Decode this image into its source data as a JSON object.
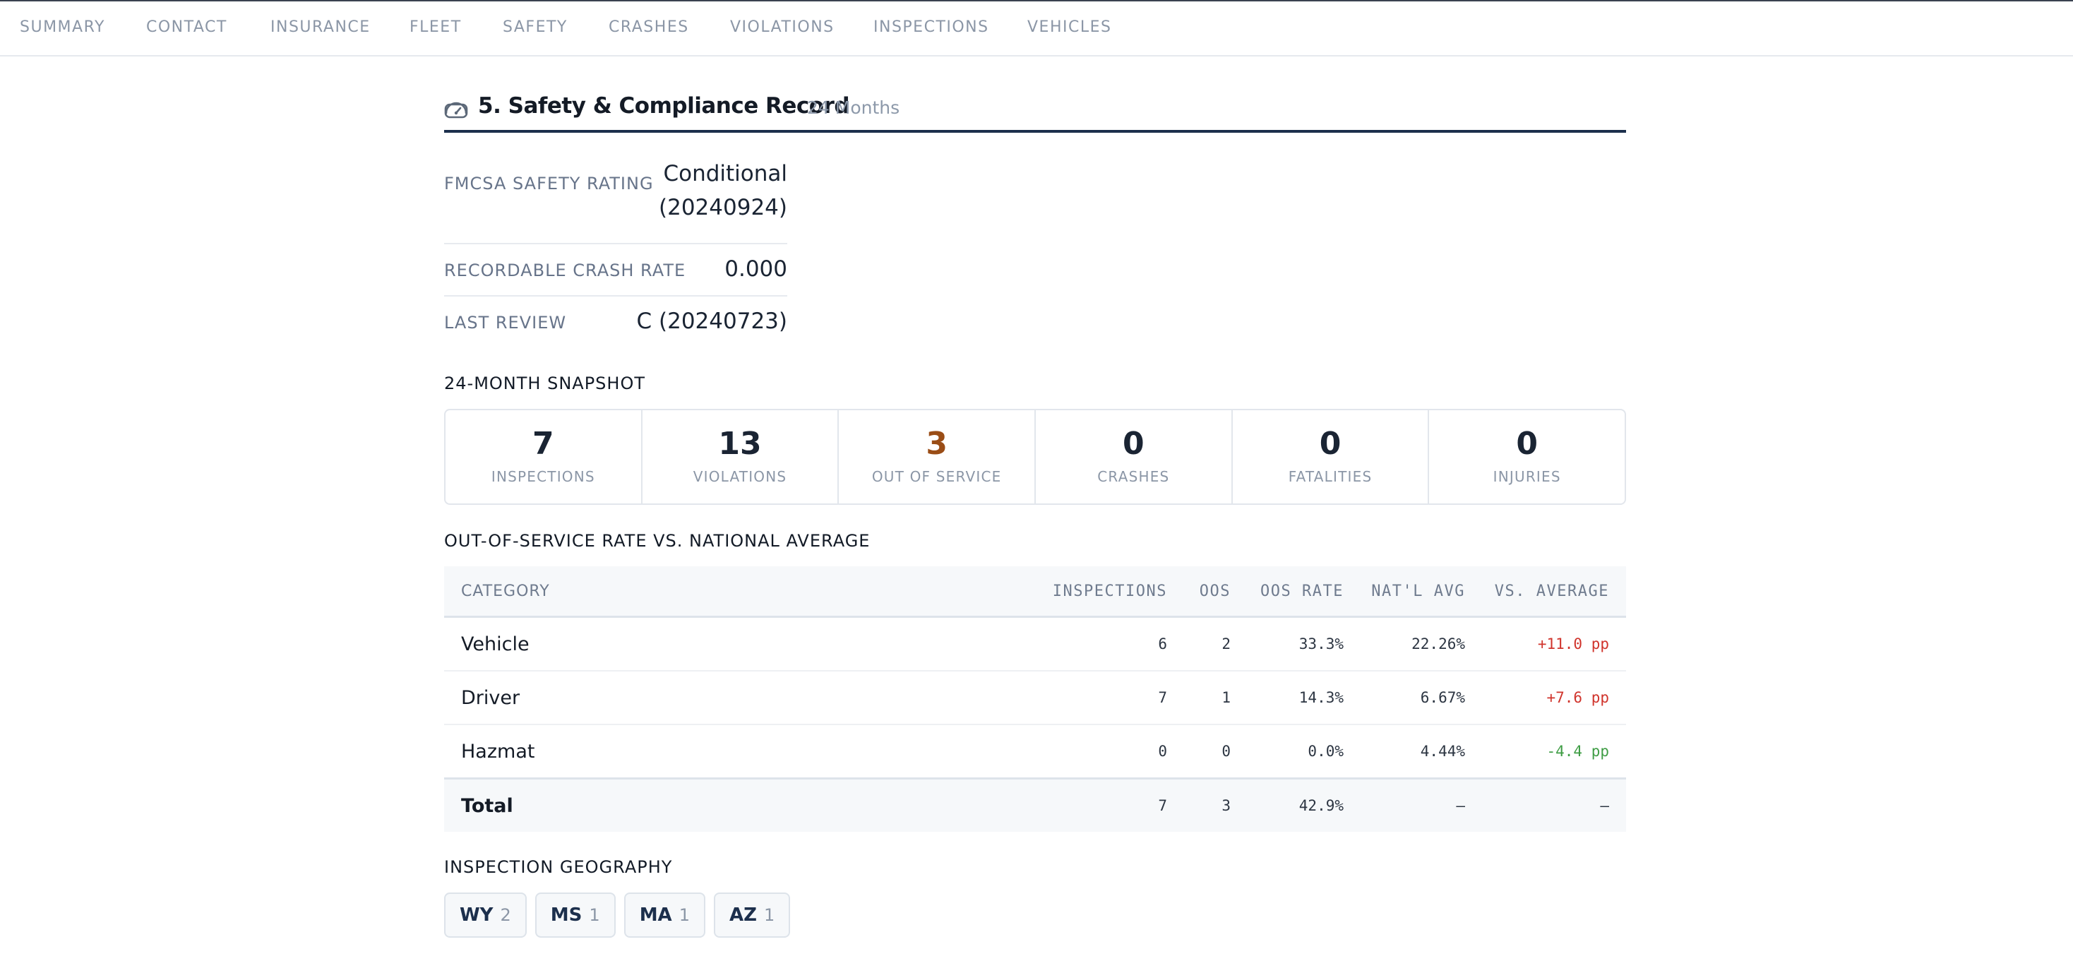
{
  "nav": {
    "tabs": [
      {
        "label": "SUMMARY"
      },
      {
        "label": "CONTACT"
      },
      {
        "label": "INSURANCE"
      },
      {
        "label": "FLEET"
      },
      {
        "label": "SAFETY"
      },
      {
        "label": "CRASHES"
      },
      {
        "label": "VIOLATIONS"
      },
      {
        "label": "INSPECTIONS"
      },
      {
        "label": "VEHICLES"
      }
    ]
  },
  "section": {
    "icon": "gauge-icon",
    "title": "5. Safety & Compliance Record",
    "subtitle": "24 Months"
  },
  "ratings": [
    {
      "label": "FMCSA SAFETY RATING",
      "value": "Conditional (20240924)"
    },
    {
      "label": "RECORDABLE CRASH RATE",
      "value": "0.000"
    },
    {
      "label": "LAST REVIEW",
      "value": "C (20240723)"
    }
  ],
  "snapshot": {
    "heading": "24-MONTH SNAPSHOT",
    "stats": [
      {
        "value": "7",
        "label": "INSPECTIONS"
      },
      {
        "value": "13",
        "label": "VIOLATIONS"
      },
      {
        "value": "3",
        "label": "OUT OF SERVICE"
      },
      {
        "value": "0",
        "label": "CRASHES"
      },
      {
        "value": "0",
        "label": "FATALITIES"
      },
      {
        "value": "0",
        "label": "INJURIES"
      }
    ],
    "accent_color": "#9a4d16"
  },
  "oos": {
    "heading": "OUT-OF-SERVICE RATE VS. NATIONAL AVERAGE",
    "columns": [
      "CATEGORY",
      "INSPECTIONS",
      "OOS",
      "OOS RATE",
      "NAT'L AVG",
      "VS. AVERAGE"
    ],
    "rows": [
      {
        "category": "Vehicle",
        "inspections": "6",
        "oos": "2",
        "rate": "33.3%",
        "avg": "22.26%",
        "vs": "+11.0 pp"
      },
      {
        "category": "Driver",
        "inspections": "7",
        "oos": "1",
        "rate": "14.3%",
        "avg": "6.67%",
        "vs": "+7.6 pp"
      },
      {
        "category": "Hazmat",
        "inspections": "0",
        "oos": "0",
        "rate": "0.0%",
        "avg": "4.44%",
        "vs": "-4.4 pp"
      }
    ],
    "total": {
      "category": "Total",
      "inspections": "7",
      "oos": "3",
      "rate": "42.9%",
      "avg": "—",
      "vs": "—"
    },
    "colors": {
      "above_avg": "#d0342c",
      "below_avg": "#3f9d45"
    }
  },
  "geography": {
    "heading": "INSPECTION GEOGRAPHY",
    "states": [
      {
        "state": "WY",
        "count": "2"
      },
      {
        "state": "MS",
        "count": "1"
      },
      {
        "state": "MA",
        "count": "1"
      },
      {
        "state": "AZ",
        "count": "1"
      }
    ]
  }
}
